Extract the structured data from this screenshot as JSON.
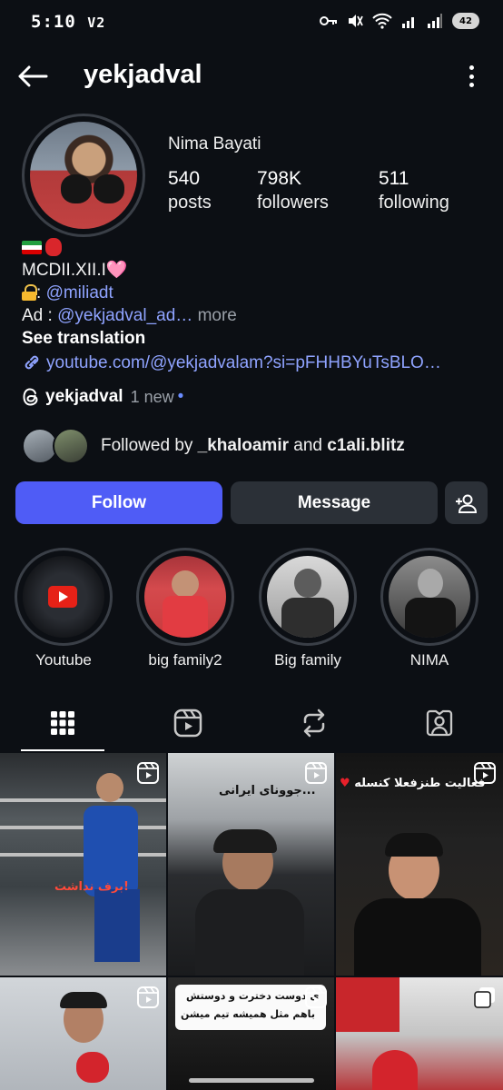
{
  "status_bar": {
    "time": "5:10",
    "carrier_tag": "V2",
    "battery": "42"
  },
  "header": {
    "username": "yekjadval"
  },
  "profile": {
    "display_name": "Nima Bayati",
    "stats": [
      {
        "value": "540",
        "label": "posts"
      },
      {
        "value": "798K",
        "label": "followers"
      },
      {
        "value": "511",
        "label": "following"
      }
    ],
    "bio": {
      "line2": "MCDII.XII.I",
      "line2_heart": "🩷",
      "lock_suffix": ":",
      "lock_mention": "@miliadt",
      "ad_prefix": "Ad :",
      "ad_mention": "@yekjadval_ad…",
      "more": "more",
      "see_translation": "See translation",
      "link": "youtube.com/@yekjadvalam?si=pFHHBYuTsBLO…"
    },
    "threads": {
      "name": "yekjadval",
      "new_label": "1 new",
      "dot": "•"
    },
    "followed_by": {
      "prefix": "Followed by",
      "user1": "_khaloamir",
      "conj": "and",
      "user2": "c1ali.blitz"
    }
  },
  "actions": {
    "follow": "Follow",
    "message": "Message"
  },
  "highlights": [
    {
      "label": "Youtube"
    },
    {
      "label": "big family2"
    },
    {
      "label": "Big family"
    },
    {
      "label": "NIMA"
    }
  ],
  "grid": {
    "post1_caption": "برف نداشت!",
    "post2_caption": "جوونای ایرانی...",
    "post3_caption": "فعالیت طنزفعلا کنسله",
    "post5_caption_line1": "ی دوست دخترت و دوستش",
    "post5_caption_line2": "باهم مثل همیشه تیم میشن"
  },
  "colors": {
    "background": "#0c0f14",
    "follow_button": "#4f5cf6",
    "secondary_button": "#2b3037",
    "link": "#8fa3ff"
  }
}
